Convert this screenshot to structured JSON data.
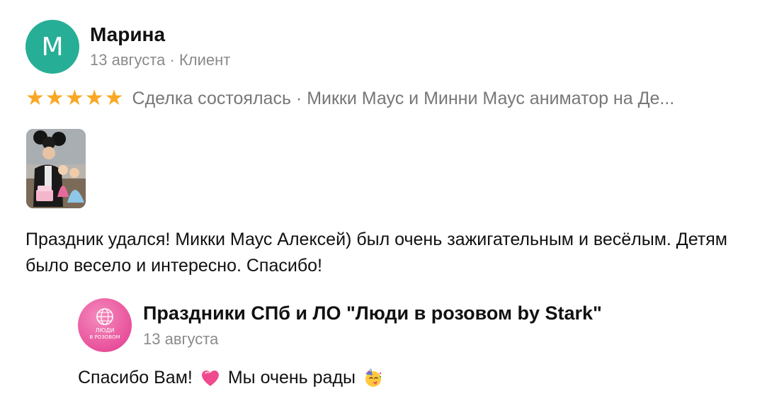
{
  "author": {
    "initial": "М",
    "name": "Марина",
    "date": "13 августа",
    "separator": "·",
    "role": "Клиент",
    "avatar_color": "#27ae96"
  },
  "rating": {
    "stars": 5,
    "star_color": "#f9a825",
    "deal_text": "Сделка состоялась · Микки Маус и Минни Маус аниматор на Де..."
  },
  "photo": {
    "icon": "review-photo"
  },
  "review": {
    "text": "Праздник удался! Микки Маус Алексей) был очень зажигательным и весёлым. Детям было весело и интересно. Спасибо!"
  },
  "reply": {
    "name": "Праздники СПб и ЛО \"Люди в розовом by Stark\"",
    "date": "13 августа",
    "text_part1": "Спасибо Вам!",
    "text_part2": "Мы очень рады",
    "logo_text_line1": "ЛЮДИ",
    "logo_text_line2": "В РОЗОВОМ",
    "logo_color": "#e8519b"
  }
}
